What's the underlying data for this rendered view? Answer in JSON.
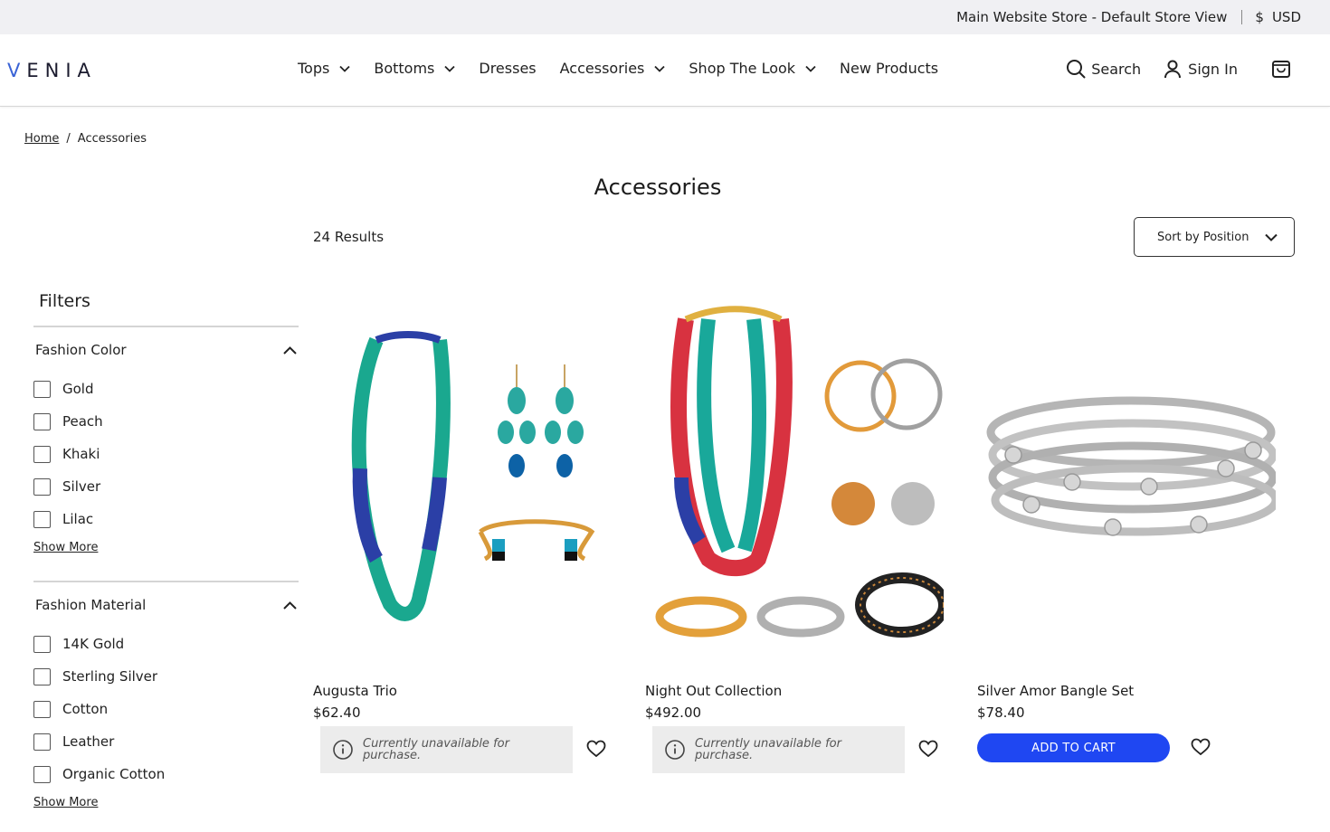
{
  "topbar": {
    "store_view": "Main Website Store - Default Store View",
    "currency_symbol": "$",
    "currency": "USD"
  },
  "header": {
    "logo": "VENIA",
    "nav": [
      {
        "label": "Tops",
        "has_dropdown": true
      },
      {
        "label": "Bottoms",
        "has_dropdown": true
      },
      {
        "label": "Dresses",
        "has_dropdown": false
      },
      {
        "label": "Accessories",
        "has_dropdown": true
      },
      {
        "label": "Shop The Look",
        "has_dropdown": true
      },
      {
        "label": "New Products",
        "has_dropdown": false
      }
    ],
    "search_label": "Search",
    "signin_label": "Sign In"
  },
  "breadcrumb": {
    "home": "Home",
    "separator": "/",
    "current": "Accessories"
  },
  "page": {
    "title": "Accessories",
    "results": "24 Results",
    "sort_label": "Sort by Position"
  },
  "filters": {
    "title": "Filters",
    "groups": [
      {
        "name": "Fashion Color",
        "options": [
          "Gold",
          "Peach",
          "Khaki",
          "Silver",
          "Lilac"
        ],
        "show_more": "Show More"
      },
      {
        "name": "Fashion Material",
        "options": [
          "14K Gold",
          "Sterling Silver",
          "Cotton",
          "Leather",
          "Organic Cotton"
        ],
        "show_more": "Show More"
      }
    ]
  },
  "products": [
    {
      "name": "Augusta Trio",
      "price": "$62.40",
      "status": "Currently unavailable for purchase."
    },
    {
      "name": "Night Out Collection",
      "price": "$492.00",
      "status": "Currently unavailable for purchase."
    },
    {
      "name": "Silver Amor Bangle Set",
      "price": "$78.40",
      "cta": "ADD TO CART"
    }
  ],
  "colors": {
    "accent": "#1f47f2",
    "topbar_bg": "#f0f0f3",
    "unavailable_bg": "#ececec"
  }
}
